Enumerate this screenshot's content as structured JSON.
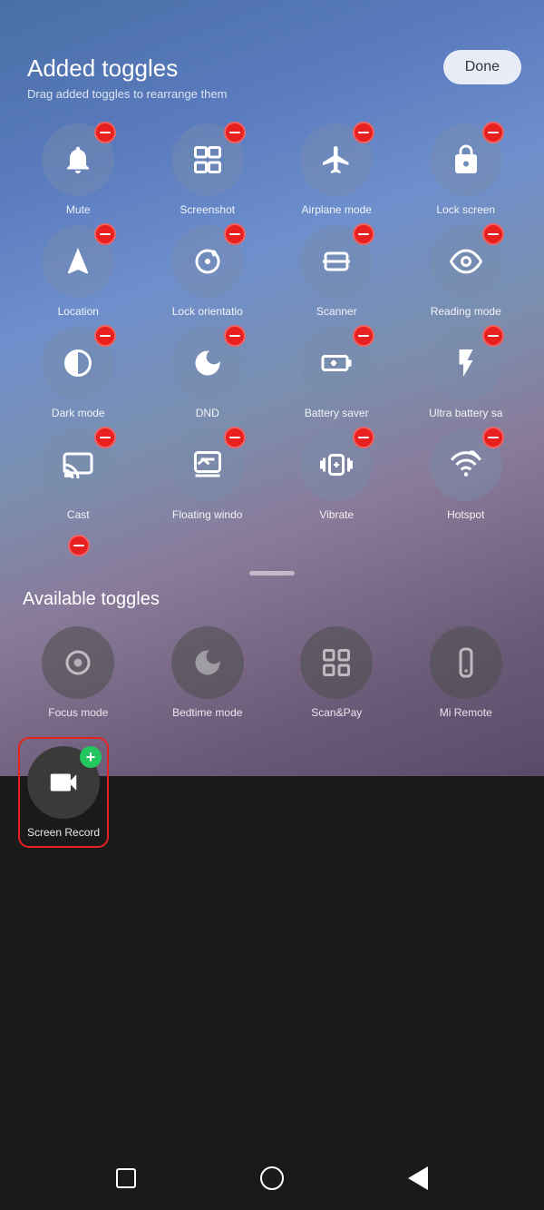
{
  "header": {
    "title": "Added toggles",
    "subtitle": "Drag added toggles to rearrange them",
    "done_label": "Done"
  },
  "added_toggles": [
    {
      "id": "mute",
      "label": "Mute",
      "icon": "bell"
    },
    {
      "id": "screenshot",
      "label": "Screenshot",
      "icon": "screenshot"
    },
    {
      "id": "airplane",
      "label": "Airplane mode",
      "icon": "airplane"
    },
    {
      "id": "lockscreen",
      "label": "Lock screen",
      "icon": "lock"
    },
    {
      "id": "location",
      "label": "Location",
      "icon": "location"
    },
    {
      "id": "lock-orientation",
      "label": "Lock orientatio",
      "icon": "rotate"
    },
    {
      "id": "scanner",
      "label": "Scanner",
      "icon": "scanner"
    },
    {
      "id": "reading",
      "label": "Reading mode",
      "icon": "eye"
    },
    {
      "id": "darkmode",
      "label": "Dark mode",
      "icon": "halfcircle"
    },
    {
      "id": "dnd",
      "label": "DND",
      "icon": "moon"
    },
    {
      "id": "battery-saver",
      "label": "Battery saver",
      "icon": "battery"
    },
    {
      "id": "ultra-battery",
      "label": "Ultra battery sa",
      "icon": "lightning"
    },
    {
      "id": "cast",
      "label": "Cast",
      "icon": "cast"
    },
    {
      "id": "floating",
      "label": "Floating windo",
      "icon": "floating"
    },
    {
      "id": "vibrate",
      "label": "Vibrate",
      "icon": "vibrate"
    },
    {
      "id": "hotspot",
      "label": "Hotspot",
      "icon": "hotspot"
    }
  ],
  "available_toggles": [
    {
      "id": "focus",
      "label": "Focus mode",
      "icon": "focus"
    },
    {
      "id": "bedtime",
      "label": "Bedtime mode",
      "icon": "bedtime"
    },
    {
      "id": "scanpay",
      "label": "Scan&Pay",
      "icon": "scanpay"
    },
    {
      "id": "miremote",
      "label": "Mi Remote",
      "icon": "miremote"
    }
  ],
  "screen_record": {
    "label": "Screen Record",
    "icon": "video-camera"
  },
  "nav": {
    "back": "back",
    "home": "home",
    "recents": "recents"
  }
}
